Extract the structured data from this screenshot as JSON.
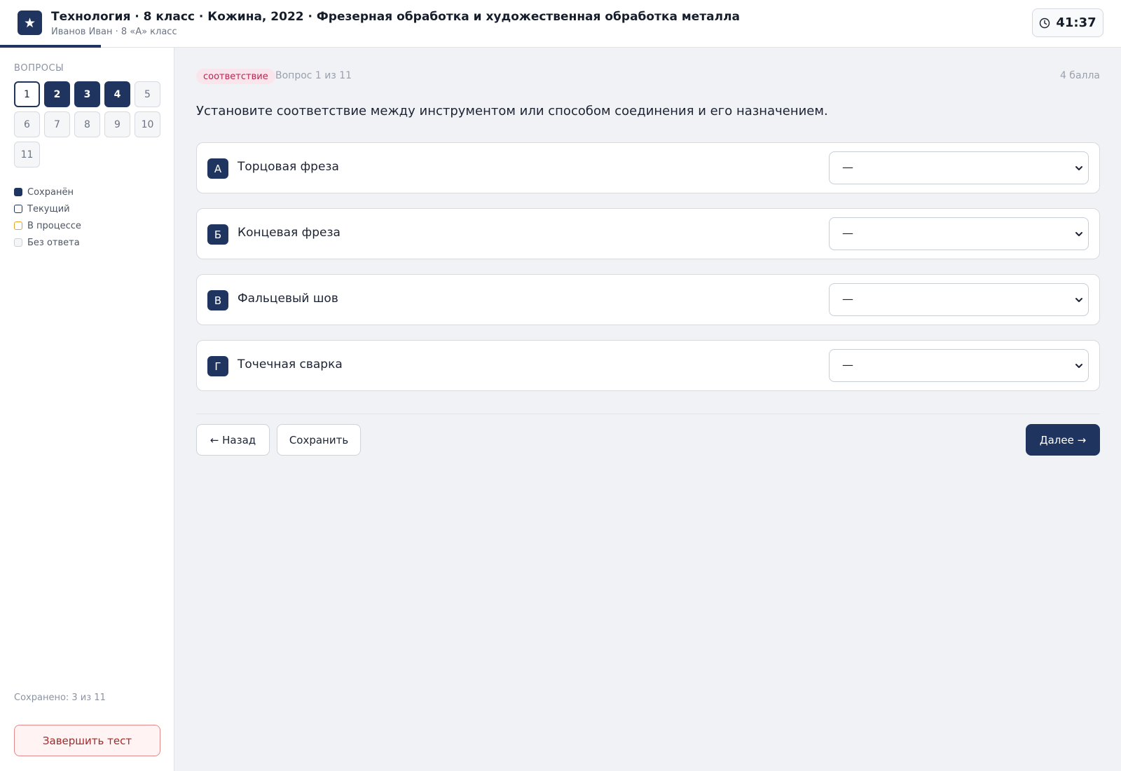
{
  "header": {
    "logo_icon": "star-icon",
    "title": "Технология · 8 класс · Кожина, 2022 · Фрезерная обработка и художественная обработка металла",
    "subtitle": "Иванов Иван · 8 «А» класс",
    "timer": "41:37",
    "timer_icon": "clock-icon"
  },
  "sidebar": {
    "heading": "Вопросы",
    "questions": [
      {
        "num": "1",
        "state": "current"
      },
      {
        "num": "2",
        "state": "saved"
      },
      {
        "num": "3",
        "state": "saved"
      },
      {
        "num": "4",
        "state": "saved"
      },
      {
        "num": "5",
        "state": "empty"
      },
      {
        "num": "6",
        "state": "empty"
      },
      {
        "num": "7",
        "state": "empty"
      },
      {
        "num": "8",
        "state": "empty"
      },
      {
        "num": "9",
        "state": "empty"
      },
      {
        "num": "10",
        "state": "empty"
      },
      {
        "num": "11",
        "state": "empty"
      }
    ],
    "legend": {
      "saved": "Сохранён",
      "current": "Текущий",
      "progress": "В процессе",
      "empty": "Без ответа"
    },
    "saved_count": "Сохранено: 3 из 11",
    "finish_label": "Завершить тест"
  },
  "main": {
    "tag": "соответствие",
    "counter": "Вопрос 1 из 11",
    "points": "4 балла",
    "question": "Установите соответствие между инструментом или способом соединения и его назначением.",
    "rows": [
      {
        "letter": "А",
        "label": "Торцовая фреза",
        "value": "—"
      },
      {
        "letter": "Б",
        "label": "Концевая фреза",
        "value": "—"
      },
      {
        "letter": "В",
        "label": "Фальцевый шов",
        "value": "—"
      },
      {
        "letter": "Г",
        "label": "Точечная сварка",
        "value": "—"
      }
    ],
    "back_label": "← Назад",
    "save_label": "Сохранить",
    "next_label": "Далее →"
  },
  "colors": {
    "accent": "#1f3560",
    "tag_bg": "#fbe5ec",
    "tag_text": "#b02a52",
    "in_progress": "#e0a526",
    "danger": "#a12a2a"
  }
}
